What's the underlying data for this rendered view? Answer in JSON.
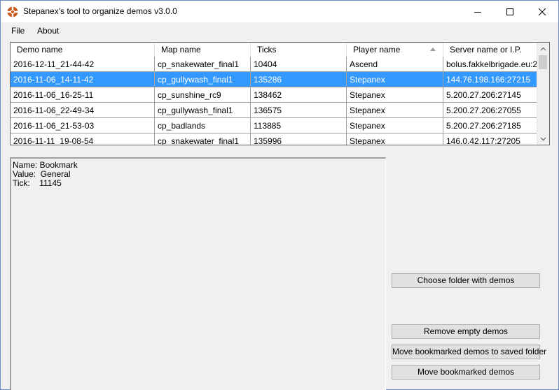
{
  "window": {
    "title": "Stepanex's tool to organize demos v3.0.0",
    "accent": "#3399ff",
    "controls": [
      "minimize-icon",
      "maximize-icon",
      "close-icon"
    ]
  },
  "menu": {
    "items": [
      "File",
      "About"
    ]
  },
  "table": {
    "columns": [
      "Demo name",
      "Map name",
      "Ticks",
      "Player name",
      "Server name or I.P."
    ],
    "sorted_column": "Player name",
    "rows": [
      [
        "2016-12-11_21-44-42",
        "cp_snakewater_final1",
        "10404",
        "Ascend",
        "bolus.fakkelbrigade.eu:2..."
      ],
      [
        "2016-11-06_14-11-42",
        "cp_gullywash_final1",
        "135286",
        "Stepanex",
        "144.76.198.166:27215"
      ],
      [
        "2016-11-06_16-25-11",
        "cp_sunshine_rc9",
        "138462",
        "Stepanex",
        "5.200.27.206:27145"
      ],
      [
        "2016-11-06_22-49-34",
        "cp_gullywash_final1",
        "136575",
        "Stepanex",
        "5.200.27.206:27055"
      ],
      [
        "2016-11-06_21-53-03",
        "cp_badlands",
        "113885",
        "Stepanex",
        "5.200.27.206:27185"
      ],
      [
        "2016-11-11_19-08-54",
        "cp_snakewater_final1",
        "135996",
        "Stepanex",
        "146.0.42.117:27205"
      ]
    ],
    "selected_row": 1
  },
  "info": {
    "lines": [
      "Name: Bookmark",
      "Value:  General",
      "Tick:    11145"
    ]
  },
  "buttons": {
    "choose_folder": "Choose folder with demos",
    "remove_empty": "Remove empty demos",
    "move_saved": "Move bookmarked demos to saved folder",
    "move_bookmarked": "Move bookmarked demos"
  }
}
